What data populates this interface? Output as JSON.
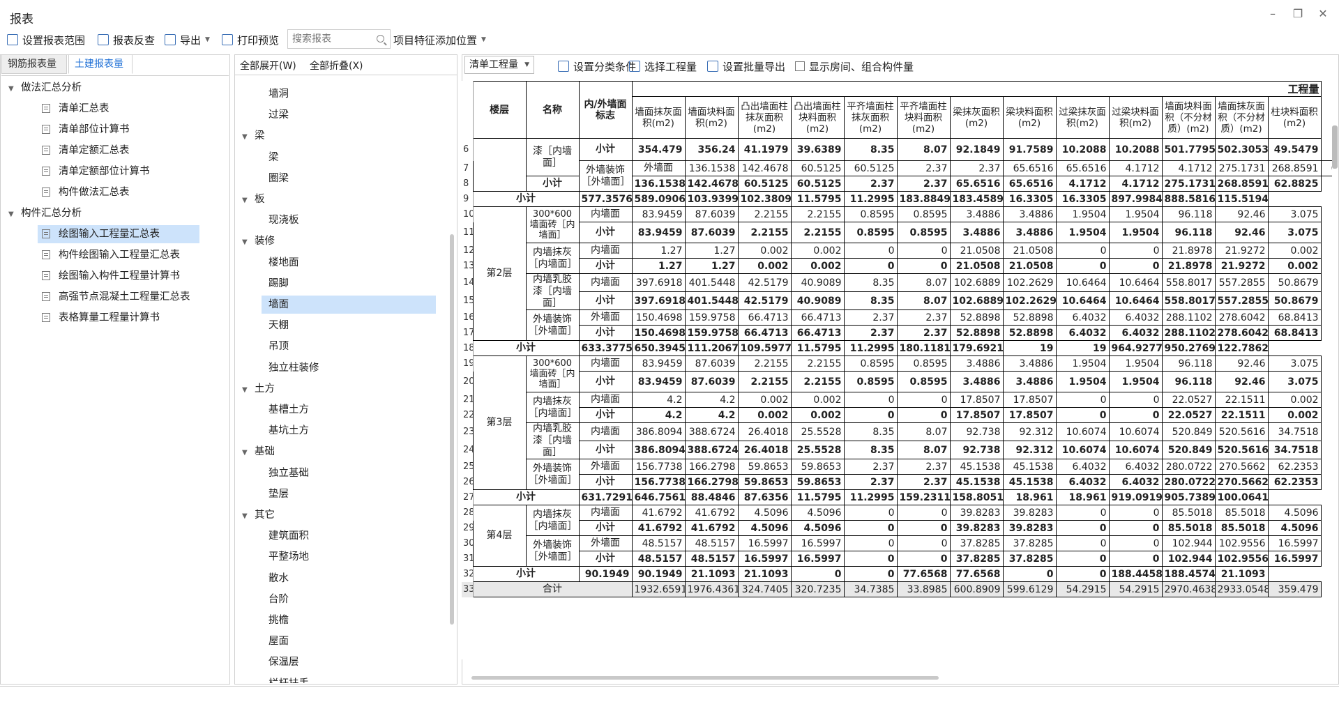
{
  "window": {
    "title": "报表"
  },
  "toolbar": {
    "set_range": "设置报表范围",
    "reverse": "报表反查",
    "export": "导出",
    "print_preview": "打印预览",
    "search_placeholder": "搜索报表",
    "add_position": "项目特征添加位置"
  },
  "left": {
    "tabs": [
      "钢筋报表量",
      "土建报表量"
    ],
    "groups": [
      {
        "label": "做法汇总分析",
        "items": [
          "清单汇总表",
          "清单部位计算书",
          "清单定额汇总表",
          "清单定额部位计算书",
          "构件做法汇总表"
        ]
      },
      {
        "label": "构件汇总分析",
        "items": [
          "绘图输入工程量汇总表",
          "构件绘图输入工程量汇总表",
          "绘图输入构件工程量计算书",
          "高强节点混凝土工程量汇总表",
          "表格算量工程量计算书"
        ]
      }
    ],
    "selected": "绘图输入工程量汇总表"
  },
  "middle": {
    "expand_all": "全部展开(W)",
    "collapse_all": "全部折叠(X)",
    "tree": [
      {
        "label": "墙洞",
        "level": 1
      },
      {
        "label": "过梁",
        "level": 1
      },
      {
        "label": "梁",
        "level": 0
      },
      {
        "label": "梁",
        "level": 1
      },
      {
        "label": "圈梁",
        "level": 1
      },
      {
        "label": "板",
        "level": 0
      },
      {
        "label": "现浇板",
        "level": 1
      },
      {
        "label": "装修",
        "level": 0
      },
      {
        "label": "楼地面",
        "level": 1
      },
      {
        "label": "踢脚",
        "level": 1
      },
      {
        "label": "墙面",
        "level": 1,
        "selected": true
      },
      {
        "label": "天棚",
        "level": 1
      },
      {
        "label": "吊顶",
        "level": 1
      },
      {
        "label": "独立柱装修",
        "level": 1
      },
      {
        "label": "土方",
        "level": 0
      },
      {
        "label": "基槽土方",
        "level": 1
      },
      {
        "label": "基坑土方",
        "level": 1
      },
      {
        "label": "基础",
        "level": 0
      },
      {
        "label": "独立基础",
        "level": 1
      },
      {
        "label": "垫层",
        "level": 1
      },
      {
        "label": "其它",
        "level": 0
      },
      {
        "label": "建筑面积",
        "level": 1
      },
      {
        "label": "平整场地",
        "level": 1
      },
      {
        "label": "散水",
        "level": 1
      },
      {
        "label": "台阶",
        "level": 1
      },
      {
        "label": "挑檐",
        "level": 1
      },
      {
        "label": "屋面",
        "level": 1
      },
      {
        "label": "保温层",
        "level": 1
      },
      {
        "label": "栏杆扶手",
        "level": 1
      }
    ]
  },
  "right": {
    "mode_select": "清单工程量",
    "set_category": "设置分类条件",
    "select_project": "选择工程量",
    "batch_export": "设置批量导出",
    "show_room": "显示房间、组合构件量",
    "group_header": "工程量",
    "headers": [
      "楼层",
      "名称",
      "内/外墙面标志",
      "墙面抹灰面积(m2)",
      "墙面块料面积(m2)",
      "凸出墙面柱抹灰面积(m2)",
      "凸出墙面柱块料面积(m2)",
      "平齐墙面柱抹灰面积(m2)",
      "平齐墙面柱块料面积(m2)",
      "梁抹灰面积(m2)",
      "梁块料面积(m2)",
      "过梁抹灰面积(m2)",
      "过梁块料面积(m2)",
      "墙面块料面积（不分材质）(m2)",
      "墙面抹灰面积（不分材质）(m2)",
      "柱块料面积(m2)"
    ],
    "rows": [
      {
        "n": "6",
        "floor": "",
        "name": "漆［内墙面］",
        "flag": "小计",
        "v": [
          "354.479",
          "356.24",
          "41.1979",
          "39.6389",
          "8.35",
          "8.07",
          "92.1849",
          "91.7589",
          "10.2088",
          "10.2088",
          "501.7795",
          "502.3053",
          "49.5479"
        ],
        "bold": true
      },
      {
        "n": "7",
        "floor": "",
        "name": "外墙装饰［外墙面］",
        "flag": "外墙面",
        "v": [
          "136.1538",
          "142.4678",
          "60.5125",
          "60.5125",
          "2.37",
          "2.37",
          "65.6516",
          "65.6516",
          "4.1712",
          "4.1712",
          "275.1731",
          "268.8591",
          "62.8825"
        ],
        "bold": false
      },
      {
        "n": "8",
        "floor": "",
        "name": "",
        "flag": "小计",
        "v": [
          "136.1538",
          "142.4678",
          "60.5125",
          "60.5125",
          "2.37",
          "2.37",
          "65.6516",
          "65.6516",
          "4.1712",
          "4.1712",
          "275.1731",
          "268.8591",
          "62.8825"
        ],
        "bold": true
      },
      {
        "n": "9",
        "floor": "",
        "name": "小计",
        "flag": "",
        "v": [
          "577.3576",
          "589.0906",
          "103.9399",
          "102.3809",
          "11.5795",
          "11.2995",
          "183.8849",
          "183.4589",
          "16.3305",
          "16.3305",
          "897.9984",
          "888.5816",
          "115.5194"
        ],
        "bold": true
      },
      {
        "n": "10",
        "floor": "第2层",
        "name": "300*600墙面砖［内墙面］",
        "flag": "内墙面",
        "v": [
          "83.9459",
          "87.6039",
          "2.2155",
          "2.2155",
          "0.8595",
          "0.8595",
          "3.4886",
          "3.4886",
          "1.9504",
          "1.9504",
          "96.118",
          "92.46",
          "3.075"
        ],
        "bold": false
      },
      {
        "n": "11",
        "floor": "",
        "name": "",
        "flag": "小计",
        "v": [
          "83.9459",
          "87.6039",
          "2.2155",
          "2.2155",
          "0.8595",
          "0.8595",
          "3.4886",
          "3.4886",
          "1.9504",
          "1.9504",
          "96.118",
          "92.46",
          "3.075"
        ],
        "bold": true
      },
      {
        "n": "12",
        "floor": "",
        "name": "内墙抹灰［内墙面］",
        "flag": "内墙面",
        "v": [
          "1.27",
          "1.27",
          "0.002",
          "0.002",
          "0",
          "0",
          "21.0508",
          "21.0508",
          "0",
          "0",
          "21.8978",
          "21.9272",
          "0.002"
        ],
        "bold": false
      },
      {
        "n": "13",
        "floor": "",
        "name": "",
        "flag": "小计",
        "v": [
          "1.27",
          "1.27",
          "0.002",
          "0.002",
          "0",
          "0",
          "21.0508",
          "21.0508",
          "0",
          "0",
          "21.8978",
          "21.9272",
          "0.002"
        ],
        "bold": true
      },
      {
        "n": "14",
        "floor": "",
        "name": "内墙乳胶漆［内墙面］",
        "flag": "内墙面",
        "v": [
          "397.6918",
          "401.5448",
          "42.5179",
          "40.9089",
          "8.35",
          "8.07",
          "102.6889",
          "102.2629",
          "10.6464",
          "10.6464",
          "558.8017",
          "557.2855",
          "50.8679"
        ],
        "bold": false
      },
      {
        "n": "15",
        "floor": "",
        "name": "",
        "flag": "小计",
        "v": [
          "397.6918",
          "401.5448",
          "42.5179",
          "40.9089",
          "8.35",
          "8.07",
          "102.6889",
          "102.2629",
          "10.6464",
          "10.6464",
          "558.8017",
          "557.2855",
          "50.8679"
        ],
        "bold": true
      },
      {
        "n": "16",
        "floor": "",
        "name": "外墙装饰［外墙面］",
        "flag": "外墙面",
        "v": [
          "150.4698",
          "159.9758",
          "66.4713",
          "66.4713",
          "2.37",
          "2.37",
          "52.8898",
          "52.8898",
          "6.4032",
          "6.4032",
          "288.1102",
          "278.6042",
          "68.8413"
        ],
        "bold": false
      },
      {
        "n": "17",
        "floor": "",
        "name": "",
        "flag": "小计",
        "v": [
          "150.4698",
          "159.9758",
          "66.4713",
          "66.4713",
          "2.37",
          "2.37",
          "52.8898",
          "52.8898",
          "6.4032",
          "6.4032",
          "288.1102",
          "278.6042",
          "68.8413"
        ],
        "bold": true
      },
      {
        "n": "18",
        "floor": "",
        "name": "小计",
        "flag": "",
        "v": [
          "633.3775",
          "650.3945",
          "111.2067",
          "109.5977",
          "11.5795",
          "11.2995",
          "180.1181",
          "179.6921",
          "19",
          "19",
          "964.9277",
          "950.2769",
          "122.7862"
        ],
        "bold": true
      },
      {
        "n": "19",
        "floor": "第3层",
        "name": "300*600墙面砖［内墙面］",
        "flag": "内墙面",
        "v": [
          "83.9459",
          "87.6039",
          "2.2155",
          "2.2155",
          "0.8595",
          "0.8595",
          "3.4886",
          "3.4886",
          "1.9504",
          "1.9504",
          "96.118",
          "92.46",
          "3.075"
        ],
        "bold": false
      },
      {
        "n": "20",
        "floor": "",
        "name": "",
        "flag": "小计",
        "v": [
          "83.9459",
          "87.6039",
          "2.2155",
          "2.2155",
          "0.8595",
          "0.8595",
          "3.4886",
          "3.4886",
          "1.9504",
          "1.9504",
          "96.118",
          "92.46",
          "3.075"
        ],
        "bold": true
      },
      {
        "n": "21",
        "floor": "",
        "name": "内墙抹灰［内墙面］",
        "flag": "内墙面",
        "v": [
          "4.2",
          "4.2",
          "0.002",
          "0.002",
          "0",
          "0",
          "17.8507",
          "17.8507",
          "0",
          "0",
          "22.0527",
          "22.1511",
          "0.002"
        ],
        "bold": false
      },
      {
        "n": "22",
        "floor": "",
        "name": "",
        "flag": "小计",
        "v": [
          "4.2",
          "4.2",
          "0.002",
          "0.002",
          "0",
          "0",
          "17.8507",
          "17.8507",
          "0",
          "0",
          "22.0527",
          "22.1511",
          "0.002"
        ],
        "bold": true
      },
      {
        "n": "23",
        "floor": "",
        "name": "内墙乳胶漆［内墙面］",
        "flag": "内墙面",
        "v": [
          "386.8094",
          "388.6724",
          "26.4018",
          "25.5528",
          "8.35",
          "8.07",
          "92.738",
          "92.312",
          "10.6074",
          "10.6074",
          "520.849",
          "520.5616",
          "34.7518"
        ],
        "bold": false
      },
      {
        "n": "24",
        "floor": "",
        "name": "",
        "flag": "小计",
        "v": [
          "386.8094",
          "388.6724",
          "26.4018",
          "25.5528",
          "8.35",
          "8.07",
          "92.738",
          "92.312",
          "10.6074",
          "10.6074",
          "520.849",
          "520.5616",
          "34.7518"
        ],
        "bold": true
      },
      {
        "n": "25",
        "floor": "",
        "name": "外墙装饰［外墙面］",
        "flag": "外墙面",
        "v": [
          "156.7738",
          "166.2798",
          "59.8653",
          "59.8653",
          "2.37",
          "2.37",
          "45.1538",
          "45.1538",
          "6.4032",
          "6.4032",
          "280.0722",
          "270.5662",
          "62.2353"
        ],
        "bold": false
      },
      {
        "n": "26",
        "floor": "",
        "name": "",
        "flag": "小计",
        "v": [
          "156.7738",
          "166.2798",
          "59.8653",
          "59.8653",
          "2.37",
          "2.37",
          "45.1538",
          "45.1538",
          "6.4032",
          "6.4032",
          "280.0722",
          "270.5662",
          "62.2353"
        ],
        "bold": true
      },
      {
        "n": "27",
        "floor": "",
        "name": "小计",
        "flag": "",
        "v": [
          "631.7291",
          "646.7561",
          "88.4846",
          "87.6356",
          "11.5795",
          "11.2995",
          "159.2311",
          "158.8051",
          "18.961",
          "18.961",
          "919.0919",
          "905.7389",
          "100.0641"
        ],
        "bold": true
      },
      {
        "n": "28",
        "floor": "第4层",
        "name": "内墙抹灰［内墙面］",
        "flag": "内墙面",
        "v": [
          "41.6792",
          "41.6792",
          "4.5096",
          "4.5096",
          "0",
          "0",
          "39.8283",
          "39.8283",
          "0",
          "0",
          "85.5018",
          "85.5018",
          "4.5096"
        ],
        "bold": false
      },
      {
        "n": "29",
        "floor": "",
        "name": "",
        "flag": "小计",
        "v": [
          "41.6792",
          "41.6792",
          "4.5096",
          "4.5096",
          "0",
          "0",
          "39.8283",
          "39.8283",
          "0",
          "0",
          "85.5018",
          "85.5018",
          "4.5096"
        ],
        "bold": true
      },
      {
        "n": "30",
        "floor": "",
        "name": "外墙装饰［外墙面］",
        "flag": "外墙面",
        "v": [
          "48.5157",
          "48.5157",
          "16.5997",
          "16.5997",
          "0",
          "0",
          "37.8285",
          "37.8285",
          "0",
          "0",
          "102.944",
          "102.9556",
          "16.5997"
        ],
        "bold": false
      },
      {
        "n": "31",
        "floor": "",
        "name": "",
        "flag": "小计",
        "v": [
          "48.5157",
          "48.5157",
          "16.5997",
          "16.5997",
          "0",
          "0",
          "37.8285",
          "37.8285",
          "0",
          "0",
          "102.944",
          "102.9556",
          "16.5997"
        ],
        "bold": true
      },
      {
        "n": "32",
        "floor": "",
        "name": "小计",
        "flag": "",
        "v": [
          "90.1949",
          "90.1949",
          "21.1093",
          "21.1093",
          "0",
          "0",
          "77.6568",
          "77.6568",
          "0",
          "0",
          "188.4458",
          "188.4574",
          "21.1093"
        ],
        "bold": true
      },
      {
        "n": "33",
        "floor": "",
        "name": "合计",
        "flag": "",
        "v": [
          "1932.6591",
          "1976.4361",
          "324.7405",
          "320.7235",
          "34.7385",
          "33.8985",
          "600.8909",
          "599.6129",
          "54.2915",
          "54.2915",
          "2970.4638",
          "2933.0548",
          "359.479"
        ],
        "bold": false
      }
    ]
  },
  "colors": {
    "accent": "#1e6fd6",
    "selected_bg": "#cde3fb"
  }
}
